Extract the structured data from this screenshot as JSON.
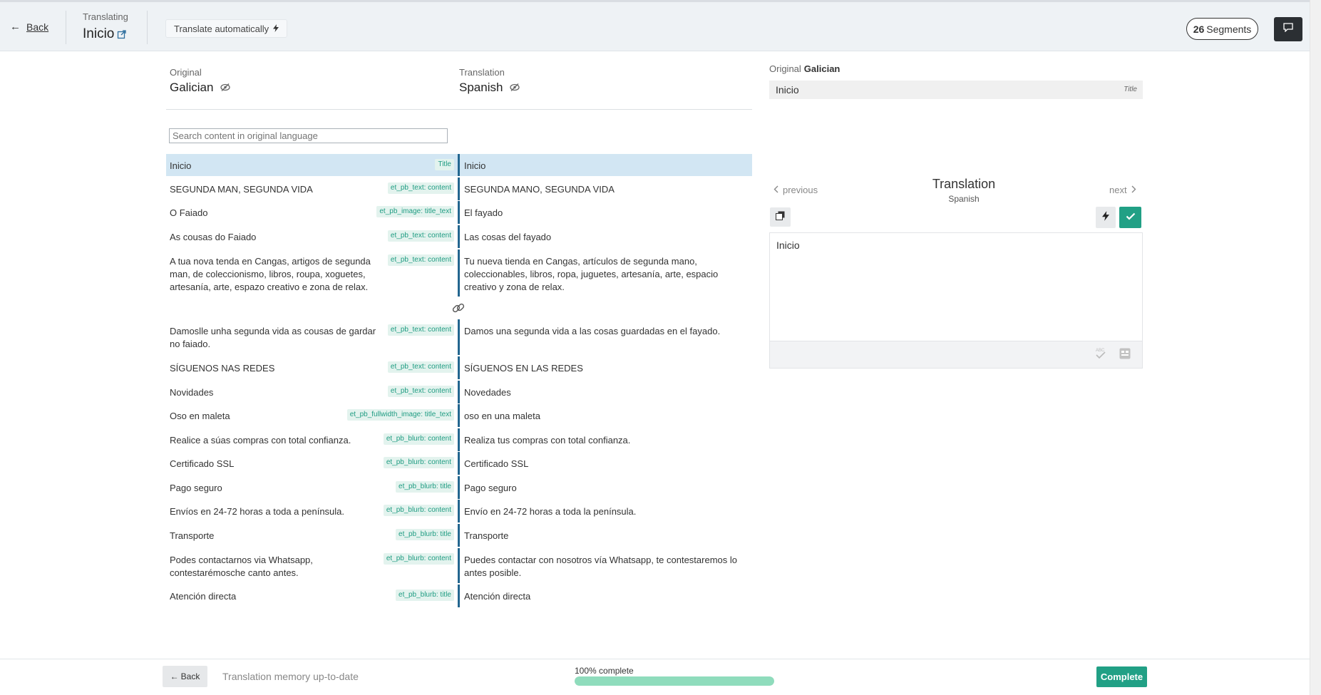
{
  "header": {
    "back_label": "Back",
    "translating_label": "Translating",
    "page_title": "Inicio",
    "auto_translate_label": "Translate automatically",
    "segments_count": "26",
    "segments_label": "Segments"
  },
  "languages": {
    "original_label": "Original",
    "original_lang": "Galician",
    "translation_label": "Translation",
    "translation_lang": "Spanish"
  },
  "search": {
    "placeholder": "Search content in original language"
  },
  "segments": [
    {
      "original": "Inicio",
      "tag": "Title",
      "translation": "Inicio"
    },
    {
      "original": "SEGUNDA MAN, SEGUNDA VIDA",
      "tag": "et_pb_text: content",
      "translation": "SEGUNDA MANO, SEGUNDA VIDA"
    },
    {
      "original": "O Faiado",
      "tag": "et_pb_image: title_text",
      "translation": "El fayado"
    },
    {
      "original": "As cousas do Faiado",
      "tag": "et_pb_text: content",
      "translation": "Las cosas del fayado"
    },
    {
      "original": "A tua nova tenda en Cangas, artigos de segunda man, de coleccionismo, libros, roupa, xoguetes, artesanía, arte, espazo creativo e zona de relax.",
      "tag": "et_pb_text: content",
      "translation": "Tu nueva tienda en Cangas, artículos de segunda mano, coleccionables, libros, ropa, juguetes, artesanía, arte, espacio creativo y zona de relax."
    },
    {
      "original": "Damoslle unha segunda vida as cousas de gardar no faiado.",
      "tag": "et_pb_text: content",
      "translation": "Damos una segunda vida a las cosas guardadas en el fayado."
    },
    {
      "original": "SÍGUENOS NAS REDES",
      "tag": "et_pb_text: content",
      "translation": "SÍGUENOS EN LAS REDES"
    },
    {
      "original": "Novidades",
      "tag": "et_pb_text: content",
      "translation": "Novedades"
    },
    {
      "original": "Oso en maleta",
      "tag": "et_pb_fullwidth_image: title_text",
      "translation": "oso en una maleta"
    },
    {
      "original": "Realice a súas compras con total confianza.",
      "tag": "et_pb_blurb: content",
      "translation": "Realiza tus compras con total confianza."
    },
    {
      "original": "Certificado SSL",
      "tag": "et_pb_blurb: content",
      "translation": "Certificado SSL"
    },
    {
      "original": "Pago seguro",
      "tag": "et_pb_blurb: title",
      "translation": "Pago seguro"
    },
    {
      "original": "Envíos en 24-72 horas a toda a península.",
      "tag": "et_pb_blurb: content",
      "translation": "Envío en 24-72 horas a toda la península."
    },
    {
      "original": "Transporte",
      "tag": "et_pb_blurb: title",
      "translation": "Transporte"
    },
    {
      "original": "Podes contactarnos via Whatsapp, contestarémosche canto antes.",
      "tag": "et_pb_blurb: content",
      "translation": "Puedes contactar con nosotros vía Whatsapp, te contestaremos lo antes posible."
    },
    {
      "original": "Atención directa",
      "tag": "et_pb_blurb: title",
      "translation": "Atención directa"
    }
  ],
  "panel": {
    "original_label": "Original",
    "original_lang": "Galician",
    "original_text": "Inicio",
    "original_tag": "Title",
    "previous_label": "previous",
    "next_label": "next",
    "title": "Translation",
    "subtitle": "Spanish",
    "editor_text": "Inicio"
  },
  "footer": {
    "back_label": "Back",
    "tm_status": "Translation memory up-to-date",
    "progress_label": "100% complete",
    "progress_value": 1.0,
    "complete_label": "Complete"
  },
  "colors": {
    "accent": "#21a085",
    "active_row": "#d2e6f3",
    "translation_border": "#23668f",
    "tag_bg": "#e3f3ee",
    "tag_text": "#1f9c82",
    "progress": "#8fdcbc"
  }
}
